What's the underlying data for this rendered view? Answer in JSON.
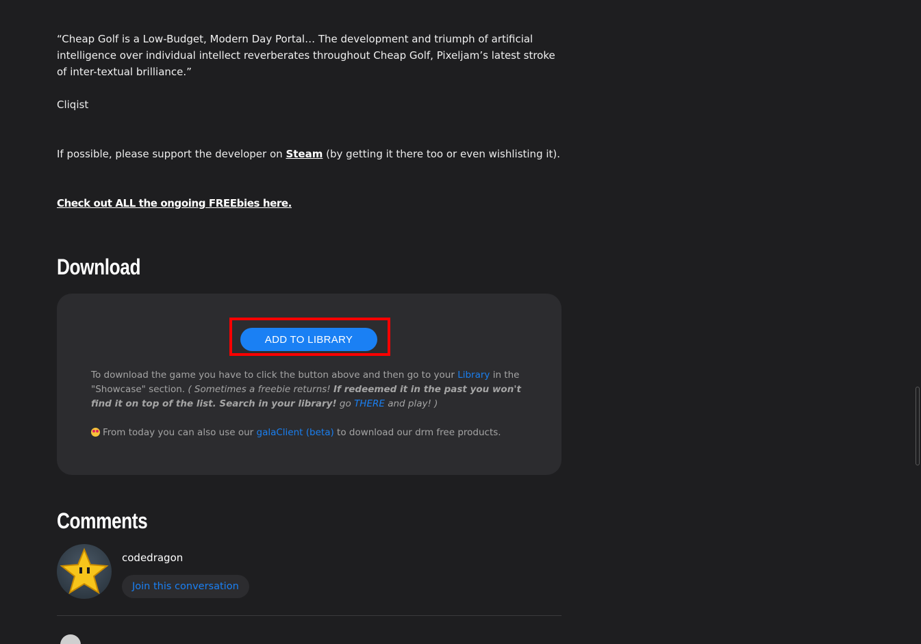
{
  "article": {
    "quote": "“Cheap Golf is a Low-Budget, Modern Day Portal… The development and triumph of artificial intelligence over individual intellect reverberates throughout Cheap Golf, Pixeljam’s latest stroke of inter-textual brilliance.”",
    "quote_source": "Cliqist",
    "support_before": "If possible, please support the developer on ",
    "support_link": "Steam",
    "support_after": " (by getting it there too or even wishlisting it).",
    "freebies_link": "Check out ALL the ongoing FREEbies here."
  },
  "download": {
    "heading": "Download",
    "add_button": "ADD TO LIBRARY",
    "instructions_1": "To download the game you have to click the button above and then go to your ",
    "library_link": "Library",
    "instructions_2": " in the \"Showcase\" section. ",
    "note_italic": "( Sometimes a freebie returns! ",
    "note_bold": "If redeemed it in the past you won't find it on top of the list. Search in your library!",
    "note_go": " go ",
    "there_link": "THERE",
    "note_end": " and play! )",
    "gala_before": "From today you can also use our ",
    "gala_link": "galaClient (beta)",
    "gala_after": " to download our drm free products."
  },
  "comments": {
    "heading": "Comments",
    "current_user": "codedragon",
    "join_button": "Join this conversation"
  },
  "colors": {
    "accent": "#1a80f4",
    "highlight": "#ff0000",
    "background": "#1e1e20",
    "panel": "#2c2c2f"
  },
  "icons": {
    "emoji": "star-struck-emoji-icon",
    "avatar": "pixel-star-avatar"
  }
}
